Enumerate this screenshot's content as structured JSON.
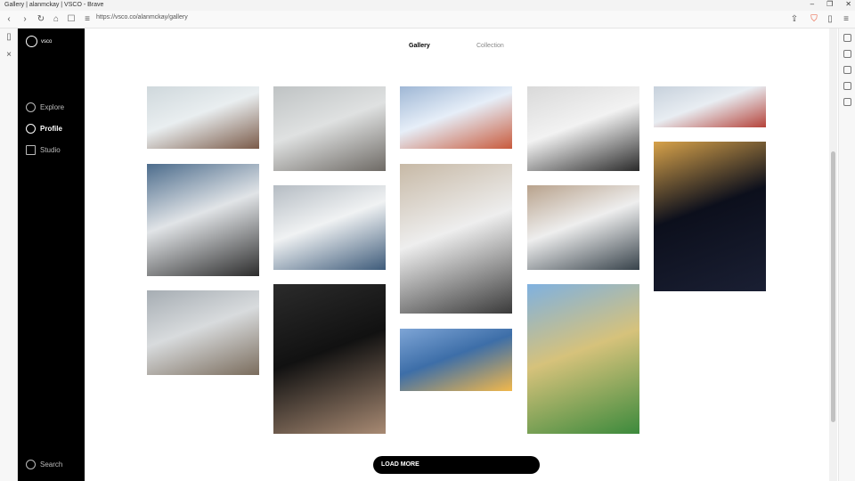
{
  "browser": {
    "window_title": "Gallery | alanmckay | VSCO - Brave",
    "url": "https://vsco.co/alanmckay/gallery"
  },
  "sidebar": {
    "logo_text": "vsco",
    "items": [
      {
        "label": "Explore"
      },
      {
        "label": "Profile"
      },
      {
        "label": "Studio"
      }
    ],
    "search_label": "Search"
  },
  "tabs": [
    {
      "label": "Gallery"
    },
    {
      "label": "Collection"
    }
  ],
  "load_more": "LOAD MORE",
  "photos": [
    {
      "subject": "frozen river with brick building",
      "colors": [
        "#cfd8dc",
        "#7a5a48",
        "#e9eef0"
      ]
    },
    {
      "subject": "foggy bridge walkway",
      "colors": [
        "#bfc3c4",
        "#6e6a65",
        "#dfe1e1"
      ]
    },
    {
      "subject": "blue snow buildings",
      "colors": [
        "#9fb7d5",
        "#c85a3c",
        "#e6eef8"
      ]
    },
    {
      "subject": "snowy branches",
      "colors": [
        "#d9d9d9",
        "#2a2a2a",
        "#f2f2f2"
      ]
    },
    {
      "subject": "colorful shops",
      "colors": [
        "#c7d1dc",
        "#b5433a",
        "#e8edf2"
      ]
    },
    {
      "subject": "underside of bridge in snow",
      "colors": [
        "#4c6c8c",
        "#2c2c2c",
        "#e1e4e7"
      ]
    },
    {
      "subject": "train on bridge in snow",
      "colors": [
        "#b5bcc3",
        "#3e5b7a",
        "#f0f2f3"
      ]
    },
    {
      "subject": "stone building facade",
      "colors": [
        "#c7b9a6",
        "#3a3a3a",
        "#eeeeee"
      ]
    },
    {
      "subject": "LIMB LAB storefront",
      "colors": [
        "#b8a28c",
        "#37424a",
        "#eeeeee"
      ]
    },
    {
      "subject": "night street lights",
      "colors": [
        "#d7a24a",
        "#1a1f33",
        "#0c0f1c"
      ]
    },
    {
      "subject": "interior staircase",
      "colors": [
        "#a6adb3",
        "#7a6c5c",
        "#d8dbdd"
      ]
    },
    {
      "subject": "dark muscular figure",
      "colors": [
        "#2b2b2b",
        "#a88a73",
        "#111111"
      ]
    },
    {
      "subject": "hot air balloons",
      "colors": [
        "#7ea5d6",
        "#f2b84b",
        "#3d6ea8"
      ]
    },
    {
      "subject": "colorful flags and cyclist",
      "colors": [
        "#7fb1e0",
        "#3c8a3c",
        "#d6c27b"
      ]
    }
  ]
}
